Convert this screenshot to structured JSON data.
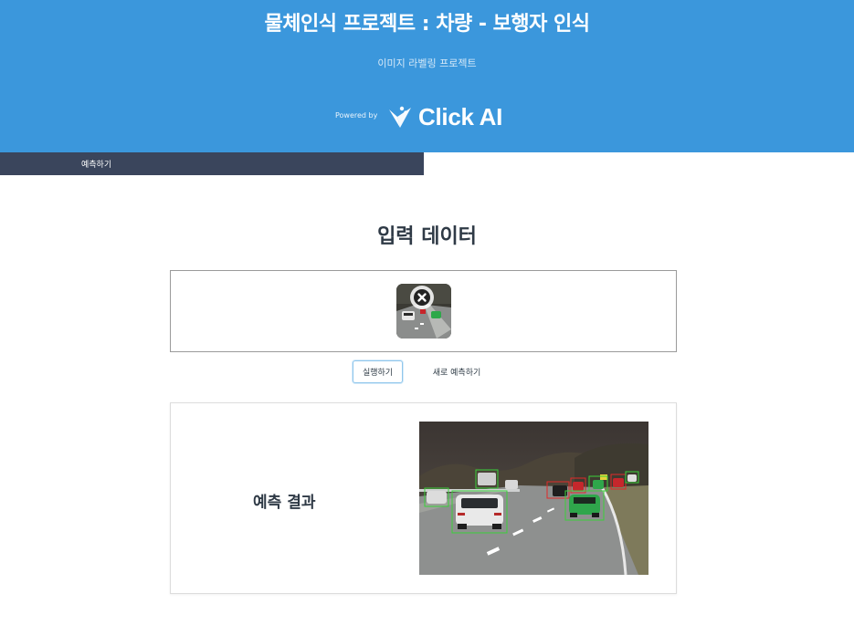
{
  "header": {
    "title": "물체인식 프로젝트 : 차량 - 보행자 인식",
    "subtitle": "이미지 라벨링 프로젝트",
    "powered_by": "Powered by",
    "logo_text": "Click AI",
    "logo_icon": "clickai-logo-icon"
  },
  "tabs": [
    {
      "label": "예측하기"
    }
  ],
  "input_section": {
    "title": "입력 데이터",
    "thumbnail_icon": "car-highway-image",
    "remove_icon": "close-icon"
  },
  "actions": {
    "run_label": "실행하기",
    "new_prediction_label": "새로 예측하기"
  },
  "result": {
    "label": "예측 결과",
    "image": "car-highway-detection-image"
  },
  "colors": {
    "header_bg": "#3b97dc",
    "tabbar_bg": "#3a455c",
    "heading_text": "#2f3a46",
    "run_button_border": "#8fc6ec",
    "detection_box_red": "#e02a2a",
    "detection_box_green": "#3ad13a"
  }
}
